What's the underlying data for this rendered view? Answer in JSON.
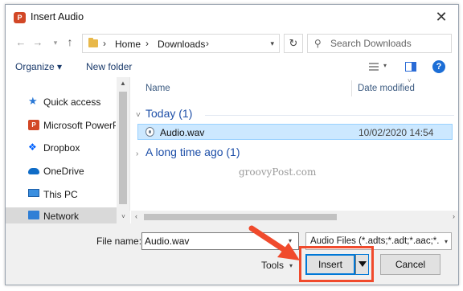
{
  "window": {
    "title": "Insert Audio",
    "app_icon_letter": "P",
    "close_glyph": "✕"
  },
  "navigation": {
    "back_glyph": "←",
    "forward_glyph": "→",
    "recent_glyph": "▾",
    "up_glyph": "↑",
    "breadcrumbs": [
      "Home",
      "Downloads"
    ],
    "separator": "›",
    "refresh_glyph": "↻",
    "search_placeholder": "Search Downloads"
  },
  "toolbar": {
    "organize_label": "Organize ▾",
    "new_folder_label": "New folder",
    "help_glyph": "?"
  },
  "sidebar": {
    "items": [
      {
        "label": "Quick access",
        "icon": "star-icon"
      },
      {
        "label": "Microsoft PowerPoint",
        "icon": "powerpoint-icon"
      },
      {
        "label": "Dropbox",
        "icon": "dropbox-icon"
      },
      {
        "label": "OneDrive",
        "icon": "onedrive-icon"
      },
      {
        "label": "This PC",
        "icon": "pc-icon"
      },
      {
        "label": "Network",
        "icon": "network-icon"
      }
    ],
    "selected_index": 5
  },
  "file_list": {
    "columns": [
      "Name",
      "Date modified"
    ],
    "groups": [
      {
        "label": "Today (1)",
        "expanded_glyph": "˅"
      },
      {
        "label": "A long time ago (1)",
        "expanded_glyph": "›"
      }
    ],
    "files": [
      {
        "name": "Audio.wav",
        "date": "10/02/2020 14:54",
        "selected": true
      }
    ]
  },
  "watermark": "groovyPost.com",
  "footer": {
    "file_name_label": "File name:",
    "file_name_value": "Audio.wav",
    "file_type_value": "Audio Files (*.adts;*.adt;*.aac;*.ai",
    "tools_label": "Tools",
    "insert_label": "Insert",
    "cancel_label": "Cancel"
  },
  "colors": {
    "accent": "#0078d7",
    "highlight": "#f04a2c",
    "selection": "#cce8ff"
  }
}
